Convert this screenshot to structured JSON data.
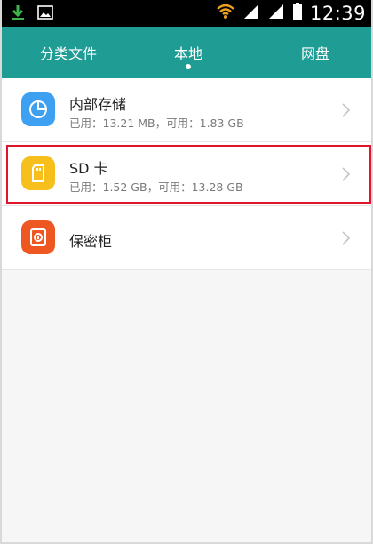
{
  "status_bar": {
    "time": "12:39",
    "icons": [
      "download-icon",
      "image-icon",
      "wifi-icon",
      "signal-icon",
      "signal-icon",
      "battery-icon"
    ]
  },
  "tabs": [
    {
      "label": "分类文件",
      "active": false
    },
    {
      "label": "本地",
      "active": true
    },
    {
      "label": "网盘",
      "active": false
    }
  ],
  "storage": [
    {
      "title": "内部存储",
      "subtitle": "已用：13.21 MB，可用：1.83 GB",
      "icon": "pie-chart-icon",
      "icon_color": "#3ea0f0"
    },
    {
      "title": "SD 卡",
      "subtitle": "已用：1.52 GB，可用：13.28 GB",
      "icon": "sd-card-icon",
      "icon_color": "#f7bf1b"
    },
    {
      "title": "保密柜",
      "subtitle": "",
      "icon": "safe-icon",
      "icon_color": "#ef5722"
    }
  ],
  "colors": {
    "app_bar": "#1f9c94",
    "highlight": "#e0142b"
  }
}
